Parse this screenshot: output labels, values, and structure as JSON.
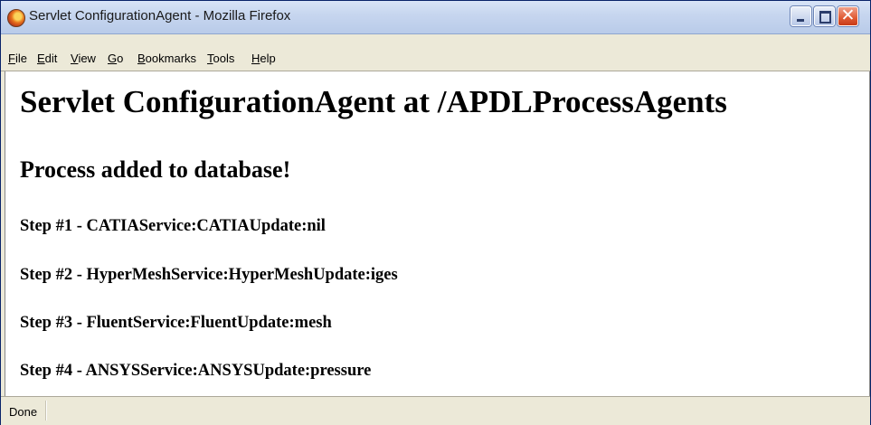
{
  "window": {
    "title": "Servlet ConfigurationAgent - Mozilla Firefox"
  },
  "menu": [
    {
      "underlined": "F",
      "rest": "ile"
    },
    {
      "underlined": "E",
      "rest": "dit"
    },
    {
      "underlined": "V",
      "rest": "iew"
    },
    {
      "underlined": "G",
      "rest": "o"
    },
    {
      "underlined": "B",
      "rest": "ookmarks"
    },
    {
      "underlined": "T",
      "rest": "ools"
    },
    {
      "underlined": "H",
      "rest": "elp"
    }
  ],
  "page": {
    "heading": "Servlet ConfigurationAgent at /APDLProcessAgents",
    "subheading": "Process added to database!",
    "steps": [
      "Step #1 - CATIAService:CATIAUpdate:nil",
      "Step #2 - HyperMeshService:HyperMeshUpdate:iges",
      "Step #3 - FluentService:FluentUpdate:mesh",
      "Step #4 - ANSYSService:ANSYSUpdate:pressure"
    ]
  },
  "status": {
    "text": "Done"
  }
}
